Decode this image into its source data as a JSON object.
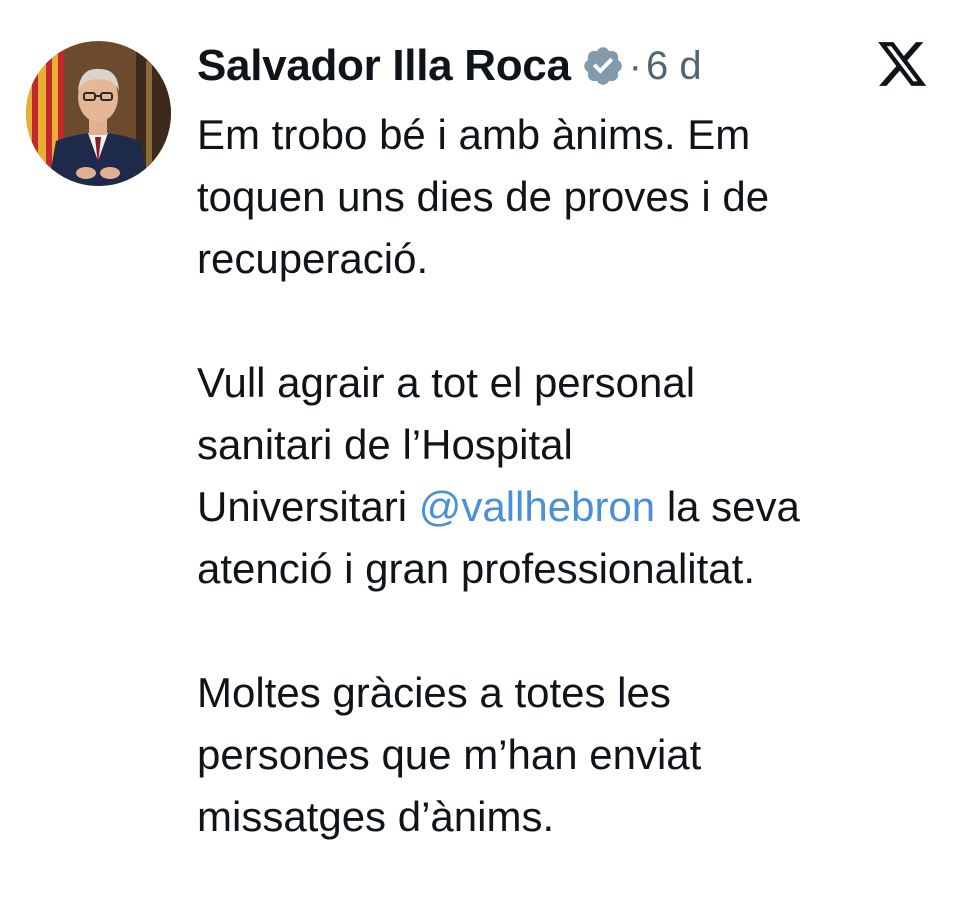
{
  "author": {
    "name": "Salvador Illa Roca",
    "verified_icon": "verified-badge-icon",
    "separator": "·",
    "time": "6 d"
  },
  "brand": {
    "logo_icon": "x-logo-icon"
  },
  "tweet": {
    "paragraph1": {
      "line1": "Em trobo bé i amb ànims. Em",
      "line2": "toquen uns dies de proves i de",
      "line3": "recuperació."
    },
    "paragraph2": {
      "line1": "Vull agrair a tot el personal",
      "line2": "sanitari de l’Hospital",
      "line3_before": "Universitari ",
      "mention": "@vallhebron",
      "line3_after": " la seva",
      "line4": "atenció i gran professionalitat."
    },
    "paragraph3": {
      "line1": "Moltes gràcies a totes les",
      "line2": "persones que m’han enviat",
      "line3": "missatges d’ànims."
    }
  },
  "colors": {
    "text": "#0f1419",
    "secondary": "#536471",
    "mention": "#4a90d9",
    "badge": "#829aab"
  }
}
